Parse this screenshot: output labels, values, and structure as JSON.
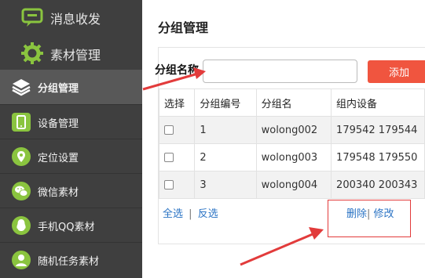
{
  "sidebar": {
    "items": [
      {
        "label": "消息收发",
        "icon": "chat-icon"
      },
      {
        "label": "素材管理",
        "icon": "gear-icon"
      },
      {
        "label": "分组管理",
        "icon": "layers-icon"
      },
      {
        "label": "设备管理",
        "icon": "phone-icon"
      },
      {
        "label": "定位设置",
        "icon": "location-icon"
      },
      {
        "label": "微信素材",
        "icon": "wechat-icon"
      },
      {
        "label": "手机QQ素材",
        "icon": "qq-icon"
      },
      {
        "label": "随机任务素材",
        "icon": "task-icon"
      }
    ],
    "active_index": 2,
    "colors": {
      "background": "#3f3f3f",
      "active": "#585858",
      "icon_green": "#8ac43f"
    }
  },
  "main": {
    "title": "分组管理",
    "form": {
      "name_label": "分组名称",
      "name_value": "",
      "add_button": "添加"
    },
    "table": {
      "headers": [
        "选择",
        "分组编号",
        "分组名",
        "组内设备"
      ],
      "rows": [
        {
          "id": "1",
          "name": "wolong002",
          "devices": "179542 179544"
        },
        {
          "id": "2",
          "name": "wolong003",
          "devices": "179548 179550"
        },
        {
          "id": "3",
          "name": "wolong004",
          "devices": "200340 200343"
        }
      ]
    },
    "footer": {
      "select_all": "全选",
      "separator": "|",
      "invert": "反选",
      "delete": "删除",
      "edit": "修改"
    },
    "colors": {
      "accent": "#f0553f",
      "link": "#2a73c4",
      "annotation": "#e23b3b"
    }
  }
}
